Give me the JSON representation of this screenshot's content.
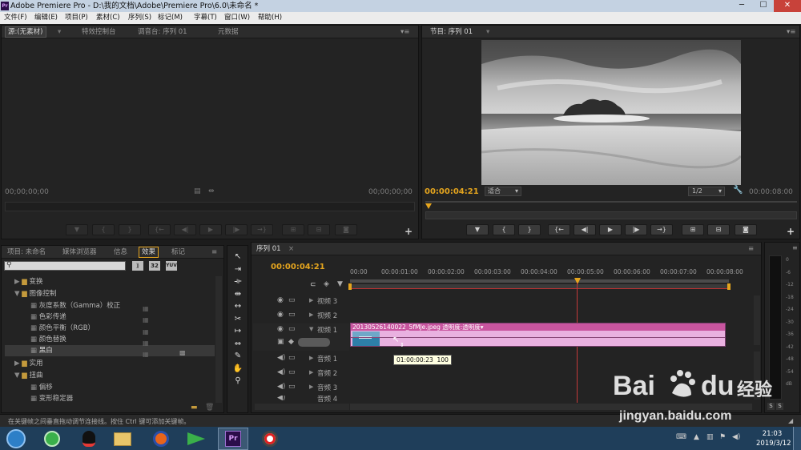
{
  "window": {
    "title": "Adobe Premiere Pro - D:\\我的文档\\Adobe\\Premiere Pro\\6.0\\未命名 *",
    "app_badge": "Pr",
    "minimize": "─",
    "maximize": "☐",
    "close": "✕"
  },
  "menu": [
    "文件(F)",
    "编辑(E)",
    "项目(P)",
    "素材(C)",
    "序列(S)",
    "标记(M)",
    "字幕(T)",
    "窗口(W)",
    "帮助(H)"
  ],
  "source_panel": {
    "tabs": [
      "源:(无素材)",
      "特效控制台",
      "调音台: 序列 01",
      "元数据"
    ],
    "tc_left": "00;00;00;00",
    "tc_right": "00;00;00;00"
  },
  "program_panel": {
    "tab": "节目: 序列 01",
    "tc_current": "00:00:04:21",
    "fit": "适合",
    "res": "1/2",
    "tc_total": "00:00:08:00"
  },
  "project_panel": {
    "tabs": [
      "项目: 未命名",
      "媒体浏览器",
      "信息",
      "效果",
      "标记"
    ],
    "search": "",
    "btn_32": "32",
    "btn_yuv": "YUV",
    "tree": [
      {
        "label": "变换",
        "arrow": "▶",
        "icon": "folder"
      },
      {
        "label": "图像控制",
        "arrow": "▼",
        "icon": "folder"
      },
      {
        "label": "灰度系数（Gamma）校正",
        "icon": "fx"
      },
      {
        "label": "色彩传递",
        "icon": "fx"
      },
      {
        "label": "颜色平衡（RGB）",
        "icon": "fx"
      },
      {
        "label": "颜色替换",
        "icon": "fx"
      },
      {
        "label": "黑白",
        "icon": "fx"
      },
      {
        "label": "实用",
        "arrow": "▶",
        "icon": "folder"
      },
      {
        "label": "扭曲",
        "arrow": "▼",
        "icon": "folder"
      },
      {
        "label": "偏移",
        "icon": "fx"
      },
      {
        "label": "变形稳定器",
        "icon": "fx"
      }
    ]
  },
  "timeline": {
    "tab": "序列 01",
    "tc": "00:00:04:21",
    "ruler": [
      "00:00",
      "00:00:01:00",
      "00:00:02:00",
      "00:00:03:00",
      "00:00:04:00",
      "00:00:05:00",
      "00:00:06:00",
      "00:00:07:00",
      "00:00:08:00"
    ],
    "video_tracks": [
      "视频 3",
      "视频 2",
      "视频 1"
    ],
    "audio_tracks": [
      "音频 1",
      "音频 2",
      "音频 3",
      "音频 4"
    ],
    "clip_name": "20130526140022_5fMJe.jpeg",
    "clip_prop": "透明度:透明度▾",
    "tooltip_tc": "01:00:00:23",
    "tooltip_val": "100"
  },
  "meter": {
    "labels": [
      "0",
      "-6",
      "-12",
      "-18",
      "-24",
      "-30",
      "-36",
      "-42",
      "-48",
      "-54",
      "dB"
    ],
    "solo": [
      "S",
      "S"
    ]
  },
  "status_text": "在关键帧之间垂直拖动调节连接线。按住 Ctrl 键可添加关键帧。",
  "taskbar": {
    "time": "21:03",
    "date": "2019/3/12"
  },
  "watermark": {
    "brand": "Bai",
    "brand2": "du",
    "text_cn": "经验",
    "url": "jingyan.baidu.com"
  }
}
